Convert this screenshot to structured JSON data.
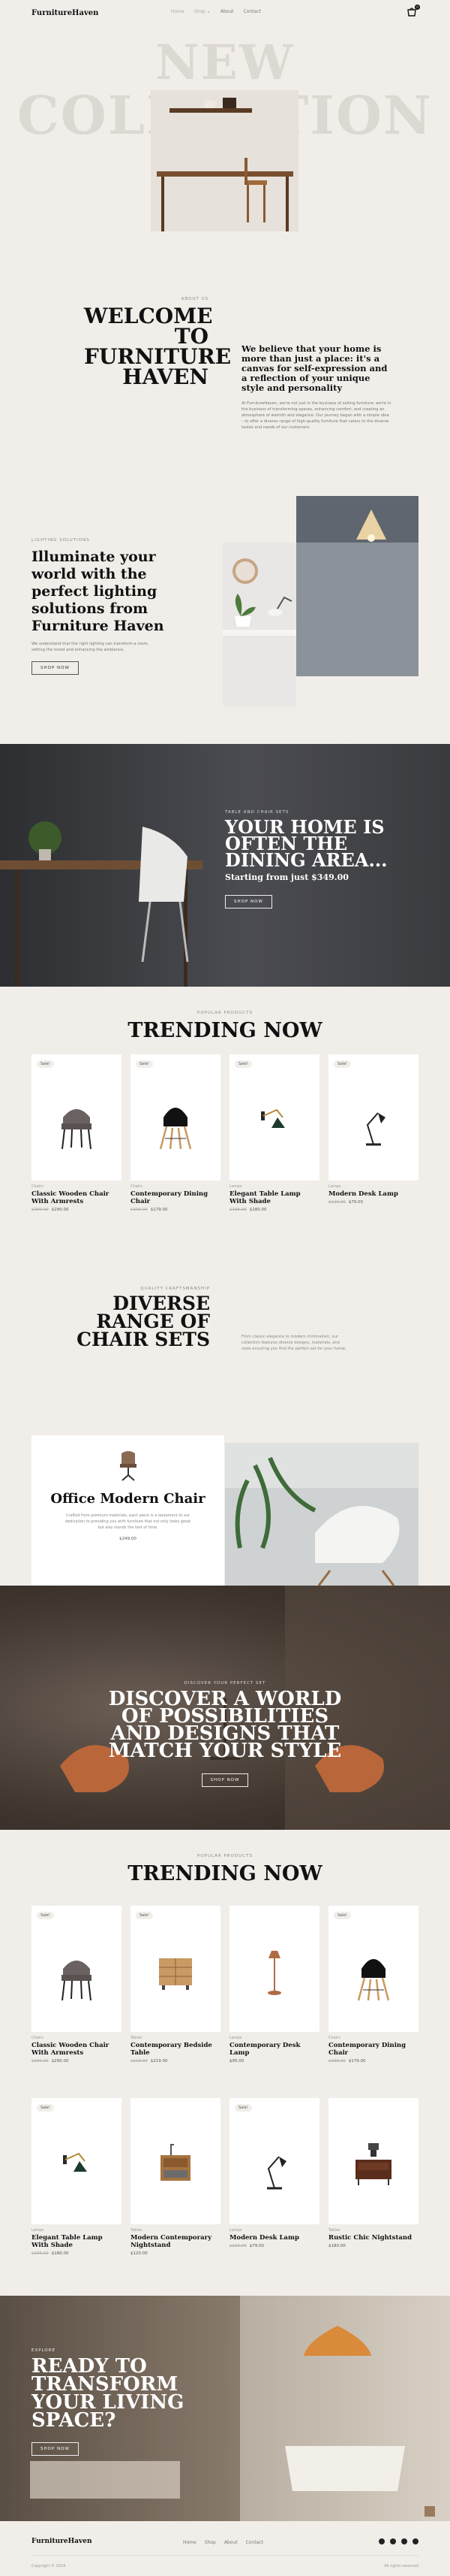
{
  "header": {
    "logo": "FurnitureHaven",
    "nav": [
      "Home",
      "Shop",
      "About",
      "Contact"
    ],
    "nav_shop_icon": "chevron-down-icon",
    "cart_count": "0"
  },
  "hero": {
    "ghost_line1": "NEW",
    "ghost_line2": "COLLECTION"
  },
  "about": {
    "eyebrow": "ABOUT US",
    "title_lines": [
      "WELCOME",
      "TO",
      "FURNITURE",
      "HAVEN"
    ],
    "headline": "We believe that your home is more than just a place: it's a canvas for self-expression and a reflection of your unique style and personality",
    "body": "At FurnitureHaven, we're not just in the business of selling furniture; we're in the business of transforming spaces, enhancing comfort, and creating an atmosphere of warmth and elegance. Our journey began with a simple idea – to offer a diverse range of high-quality furniture that caters to the diverse tastes and needs of our customers."
  },
  "lighting": {
    "eyebrow": "LIGHTING SOLUTIONS",
    "title": "Illuminate your world with the perfect lighting solutions from Furniture Haven",
    "body": "We understand that the right lighting can transform a room, setting the mood and enhancing the ambiance.",
    "button": "SHOP NOW"
  },
  "dining": {
    "eyebrow": "TABLE AND CHAIR SETS",
    "title": "YOUR HOME IS OFTEN THE DINING AREA...",
    "subtitle": "Starting from just $349.00",
    "button": "SHOP NOW"
  },
  "trending1": {
    "eyebrow": "POPULAR PRODUCTS",
    "title": "TRENDING NOW",
    "products": [
      {
        "sale": "Sale!",
        "category": "Chairs",
        "name": "Classic Wooden Chair With Armrests",
        "old": "$300.00",
        "price": "$290.00",
        "icon": "chair-grey"
      },
      {
        "sale": "Sale!",
        "category": "Chairs",
        "name": "Contemporary Dining Chair",
        "old": "$199.00",
        "price": "$179.00",
        "icon": "chair-black"
      },
      {
        "sale": "Sale!",
        "category": "Lamps",
        "name": "Elegant Table Lamp With Shade",
        "old": "$195.00",
        "price": "$180.00",
        "icon": "wall-lamp"
      },
      {
        "sale": "Sale!",
        "category": "Lamps",
        "name": "Modern Desk Lamp",
        "old": "$120.00",
        "price": "$79.00",
        "icon": "desk-lamp"
      }
    ]
  },
  "chairs": {
    "eyebrow": "QUALITY CRAFTSMANSHIP",
    "title_lines": [
      "DIVERSE",
      "RANGE OF",
      "CHAIR SETS"
    ],
    "desc": "From classic elegance to modern minimalism, our collection features diverse designs, materials, and sizes ensuring you find the perfect set for your home.",
    "card_title": "Office Modern Chair",
    "card_body": "Crafted from premium materials, each piece is a testament to our dedication to providing you with furniture that not only looks great but also stands the test of time.",
    "card_price": "$249.00"
  },
  "discover": {
    "eyebrow": "DISCOVER YOUR PERFECT SET",
    "title": "DISCOVER A WORLD OF POSSIBILITIES AND DESIGNS THAT MATCH YOUR STYLE",
    "button": "SHOP NOW"
  },
  "trending2": {
    "eyebrow": "POPULAR PRODUCTS",
    "title": "TRENDING NOW",
    "products": [
      {
        "sale": "Sale!",
        "category": "Chairs",
        "name": "Classic Wooden Chair With Armrests",
        "old": "$300.00",
        "price": "$290.00",
        "icon": "chair-grey"
      },
      {
        "sale": "Sale!",
        "category": "Tables",
        "name": "Contemporary Bedside Table",
        "old": "$219.00",
        "price": "$219.00",
        "icon": "dresser"
      },
      {
        "sale": "",
        "category": "Lamps",
        "name": "Contemporary Desk Lamp",
        "old": "",
        "price": "$95.00",
        "icon": "copper-lamp"
      },
      {
        "sale": "Sale!",
        "category": "Chairs",
        "name": "Contemporary Dining Chair",
        "old": "$199.00",
        "price": "$179.00",
        "icon": "chair-black"
      },
      {
        "sale": "Sale!",
        "category": "Lamps",
        "name": "Elegant Table Lamp With Shade",
        "old": "$195.00",
        "price": "$180.00",
        "icon": "wall-lamp"
      },
      {
        "sale": "",
        "category": "Tables",
        "name": "Modern Contemporary Nightstand",
        "old": "",
        "price": "$120.00",
        "icon": "nightstand-wood"
      },
      {
        "sale": "Sale!",
        "category": "Lamps",
        "name": "Modern Desk Lamp",
        "old": "$120.00",
        "price": "$79.00",
        "icon": "desk-lamp"
      },
      {
        "sale": "",
        "category": "Tables",
        "name": "Rustic Chic Nightstand",
        "old": "",
        "price": "$180.00",
        "icon": "nightstand-dark"
      }
    ]
  },
  "explore": {
    "eyebrow": "EXPLORE",
    "title": "READY TO TRANSFORM YOUR LIVING SPACE?",
    "button": "SHOP NOW"
  },
  "footer": {
    "logo": "FurnitureHaven",
    "nav": [
      "Home",
      "Shop",
      "About",
      "Contact"
    ],
    "copyright": "Copyright © 2024",
    "rights": "All rights reserved"
  }
}
